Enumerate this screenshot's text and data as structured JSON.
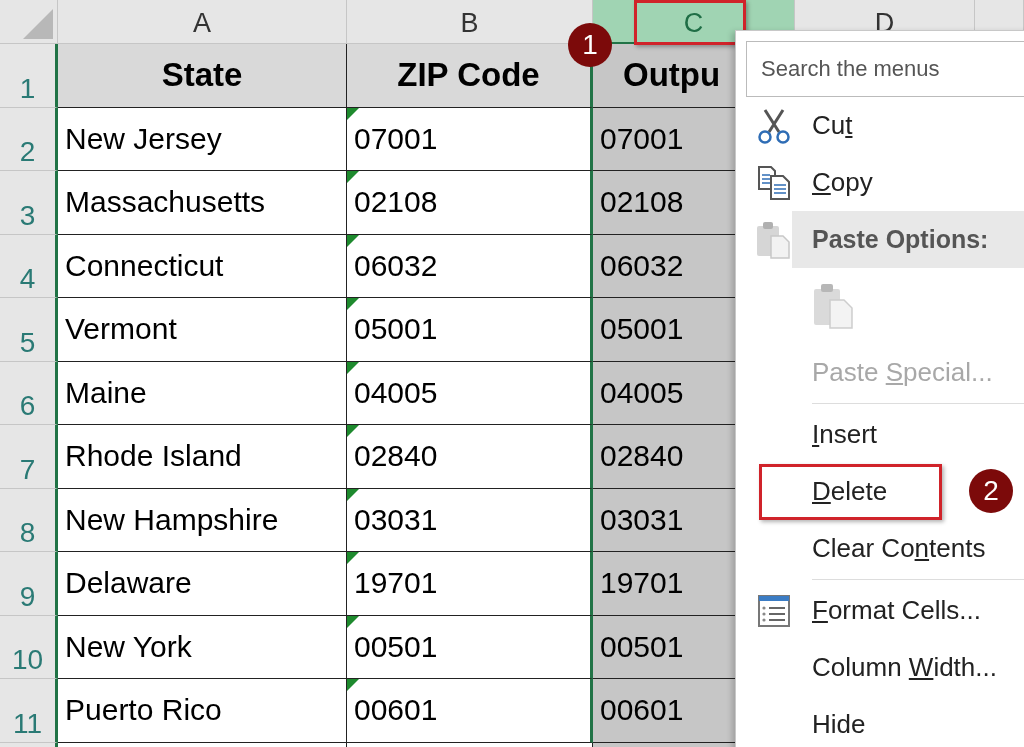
{
  "columns": [
    {
      "label": "A",
      "selected": false
    },
    {
      "label": "B",
      "selected": false
    },
    {
      "label": "C",
      "selected": true
    },
    {
      "label": "D",
      "selected": false
    }
  ],
  "rows": [
    {
      "number": "1",
      "kind": "header",
      "flag": false,
      "cells": [
        "State",
        "ZIP Code",
        "Outpu"
      ]
    },
    {
      "number": "2",
      "kind": "data",
      "flag": true,
      "cells": [
        "New Jersey",
        "07001",
        "07001"
      ]
    },
    {
      "number": "3",
      "kind": "data",
      "flag": true,
      "cells": [
        "Massachusetts",
        "02108",
        "02108"
      ]
    },
    {
      "number": "4",
      "kind": "data",
      "flag": true,
      "cells": [
        "Connecticut",
        "06032",
        "06032"
      ]
    },
    {
      "number": "5",
      "kind": "data",
      "flag": true,
      "cells": [
        "Vermont",
        "05001",
        "05001"
      ]
    },
    {
      "number": "6",
      "kind": "data",
      "flag": true,
      "cells": [
        "Maine",
        "04005",
        "04005"
      ]
    },
    {
      "number": "7",
      "kind": "data",
      "flag": true,
      "cells": [
        "Rhode Island",
        "02840",
        "02840"
      ]
    },
    {
      "number": "8",
      "kind": "data",
      "flag": true,
      "cells": [
        "New Hampshire",
        "03031",
        "03031"
      ]
    },
    {
      "number": "9",
      "kind": "data",
      "flag": true,
      "cells": [
        "Delaware",
        "19701",
        "19701"
      ]
    },
    {
      "number": "10",
      "kind": "data",
      "flag": true,
      "cells": [
        "New York",
        "00501",
        "00501"
      ]
    },
    {
      "number": "11",
      "kind": "data",
      "flag": true,
      "cells": [
        "Puerto Rico",
        "00601",
        "00601"
      ]
    }
  ],
  "context_menu": {
    "search": {
      "placeholder": "Search the menus"
    },
    "items": [
      {
        "kind": "item",
        "pre": "Cu",
        "key": "t",
        "disabled": false,
        "callout": false
      },
      {
        "kind": "item",
        "key": "C",
        "post": "opy",
        "disabled": false,
        "callout": false
      },
      {
        "kind": "header",
        "label": "Paste Options:"
      },
      {
        "kind": "paste-row",
        "disabled": true
      },
      {
        "kind": "item",
        "pre": "Paste ",
        "key": "S",
        "post": "pecial...",
        "disabled": true,
        "callout": false
      },
      {
        "kind": "separator"
      },
      {
        "kind": "item",
        "key": "I",
        "post": "nsert",
        "disabled": false,
        "callout": false
      },
      {
        "kind": "item",
        "key": "D",
        "post": "elete",
        "disabled": false,
        "callout": true
      },
      {
        "kind": "item",
        "pre": "Clear Co",
        "key": "n",
        "post": "tents",
        "disabled": false,
        "callout": false
      },
      {
        "kind": "separator"
      },
      {
        "kind": "item",
        "key": "F",
        "post": "ormat Cells...",
        "disabled": false,
        "callout": false
      },
      {
        "kind": "item",
        "pre": "Column ",
        "key": "W",
        "post": "idth...",
        "disabled": false,
        "callout": false
      },
      {
        "kind": "item",
        "pre": "Hide",
        "disabled": false,
        "callout": false
      }
    ]
  },
  "callouts": [
    {
      "number": "1"
    },
    {
      "number": "2"
    }
  ]
}
